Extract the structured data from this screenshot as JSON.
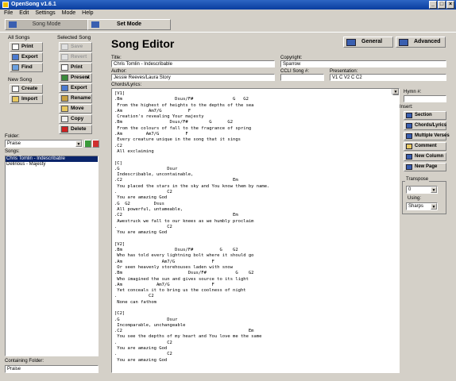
{
  "window": {
    "title": "OpenSong v1.6.1"
  },
  "menu": [
    "File",
    "Edit",
    "Settings",
    "Mode",
    "Help"
  ],
  "mode_tabs": {
    "song": "Song Mode",
    "set": "Set Mode"
  },
  "all_songs": {
    "label": "All Songs",
    "print": "Print",
    "export": "Export",
    "find": "Find"
  },
  "new_song": {
    "label": "New Song",
    "create": "Create",
    "import": "Import"
  },
  "selected_song": {
    "label": "Selected Song",
    "save": "Save",
    "revert": "Revert",
    "print": "Print",
    "present": "Present",
    "export": "Export",
    "rename": "Rename",
    "move": "Move",
    "copy": "Copy",
    "delete": "Delete"
  },
  "folder": {
    "label": "Folder:",
    "value": "Praise"
  },
  "songs": {
    "label": "Songs:",
    "items": [
      "Chris Tomlin - Indescribable",
      "Delirious - Majesty"
    ],
    "selected_index": 0
  },
  "containing_folder": {
    "label": "Containing Folder:",
    "value": "Praise"
  },
  "editor": {
    "heading": "Song Editor",
    "general_button": "General",
    "advanced_button": "Advanced",
    "title_label": "Title:",
    "title_value": "Chris Tomlin - Indescribable",
    "copyright_label": "Copyright:",
    "copyright_value": "Sparrow",
    "author_label": "Author:",
    "author_value": "Jessie Reeves/Laura Story",
    "ccli_label": "CCLI Song #:",
    "ccli_value": "",
    "presentation_label": "Presentation:",
    "presentation_value": "V1 C V2 C C2",
    "lyrics_label": "Chords/Lyrics:",
    "lyrics_lines": [
      "[V1]",
      ".Bm                    Dsus/F#               G   G2",
      " From the highest of heights to the depths of the sea",
      ".Am          Am7/G          F",
      " Creation's revealing Your majesty",
      ".Bm                  Dsus/F#        G      G2",
      " From the colours of fall to the fragrance of spring",
      ".Am         Am7/G          F",
      " Every creature unique in the song that it sings",
      ".C2",
      " All exclaiming",
      "",
      "[C]",
      ".G                  Dsur",
      " Indescribable, uncontainable,",
      ".C2                                          Em",
      " You placed the stars in the sky and You know them by name.",
      ".                   C2",
      " You are amazing God",
      ".G  G2         Dsus",
      " All powerful, untameable,",
      ".C2                                          Em",
      " Awestruck we fall to our knees as we humbly proclaim",
      ".                   C2",
      " You are amazing God",
      "",
      "[V2]",
      ".Bm                    Dsus/F#          G    G2",
      " Who has told every lightning bolt where it should go",
      ".Am               Am7/G              F",
      " Or seen heavenly storehouses laden with snow",
      ".Bm                         Dsus/F#           G    G2",
      " Who imagined the sun and gives source to its light",
      ".Am             Am7/G                F",
      " Yet conceals it to bring us the coolness of night",
      ".            C2",
      " None can fathom",
      "",
      "[C2]",
      ".G                  Dsur",
      " Incomparable, unchangeable",
      ".C2                                                Em",
      " You see the depths of my heart and You love me the same",
      ".                   C2",
      " You are amazing God",
      ".                   C2",
      " You are amazing God"
    ]
  },
  "right_panel": {
    "hymn_label": "Hymn #:",
    "hymn_value": "",
    "insert_label": "Insert:",
    "insert_buttons": [
      "Section",
      "Chords/Lyrics",
      "Multiple Verses",
      "Comment",
      "New Column",
      "New Page"
    ],
    "transpose_label": "Transpose",
    "transpose_value": "0",
    "using_label": "Using:",
    "using_value": "Sharps"
  }
}
